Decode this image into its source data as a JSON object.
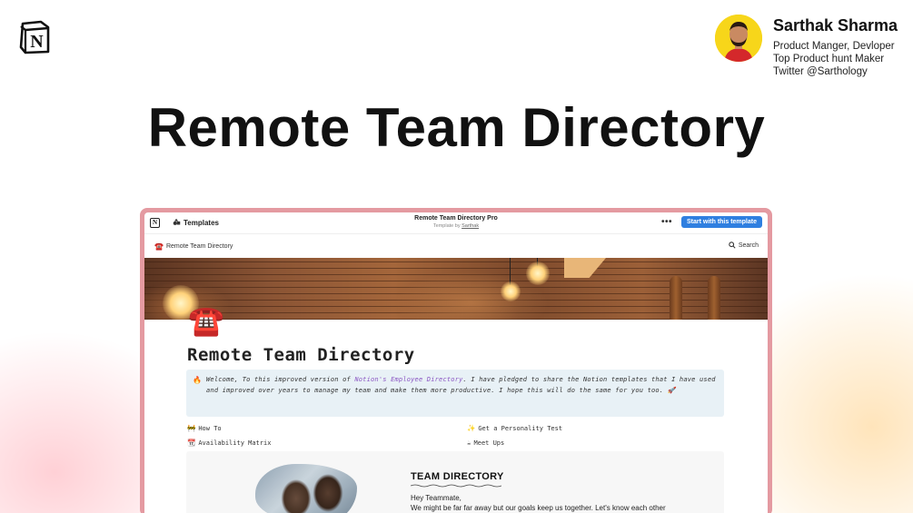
{
  "hero": {
    "title": "Remote Team Directory"
  },
  "author": {
    "name": "Sarthak Sharma",
    "lines": [
      "Product Manger, Devloper",
      "Top Product hunt Maker",
      "Twitter @Sarthology"
    ],
    "avatar_bg": "#f7d61a"
  },
  "notion_logo": {
    "icon": "notion-logo-icon",
    "letter": "N"
  },
  "window": {
    "topbar": {
      "logo_letter": "N",
      "templates_label": "Templates",
      "center_title": "Remote Team Directory Pro",
      "center_sub_prefix": "Template by",
      "center_sub_author": "Sarthak",
      "more_label": "•••",
      "start_button": "Start with this template",
      "accent": "#2f7fe0"
    },
    "breadcrumb": {
      "icon": "telephone-icon",
      "label": "Remote Team Directory"
    },
    "search_label": "Search",
    "page": {
      "icon": "☎️",
      "title": "Remote Team Directory",
      "callout": {
        "icon": "🔥",
        "text_before": "Welcome, To this improved version of ",
        "highlight": "Notion's Employee Directory",
        "text_after": ". I have pledged to share the Notion templates that I have used and improved over years to manage my team and make them more productive. I hope this will do the same for you too. 🚀"
      },
      "links": [
        {
          "icon": "🚧",
          "label": "How To"
        },
        {
          "icon": "✨",
          "label": "Get a Personality Test"
        },
        {
          "icon": "📆",
          "label": "Availability Matrix"
        },
        {
          "icon": "☕",
          "label": "Meet Ups"
        }
      ],
      "embed": {
        "title": "TEAM DIRECTORY",
        "greeting": "Hey Teammate,",
        "body": "We might be far far away but our goals keep us together. Let's know each other better with this directory. Be honest filling this up yours and patient while reading."
      }
    }
  }
}
